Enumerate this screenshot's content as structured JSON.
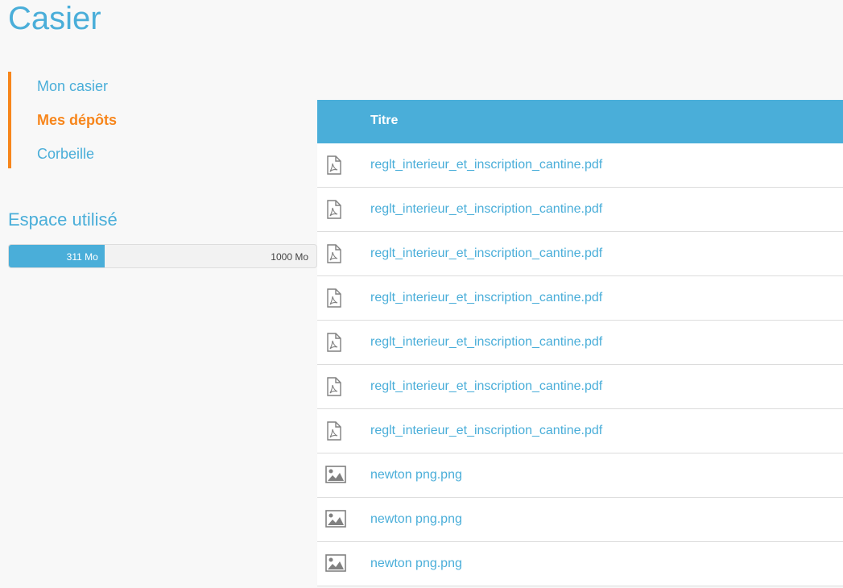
{
  "page": {
    "title": "Casier"
  },
  "nav": {
    "items": [
      {
        "label": "Mon casier",
        "active": false
      },
      {
        "label": "Mes dépôts",
        "active": true
      },
      {
        "label": "Corbeille",
        "active": false
      }
    ]
  },
  "usage": {
    "title": "Espace utilisé",
    "used_label": "311 Mo",
    "total_label": "1000 Mo",
    "used_fraction": 0.311
  },
  "table": {
    "header_title": "Titre",
    "rows": [
      {
        "icon": "pdf-file-icon",
        "name": "reglt_interieur_et_inscription_cantine.pdf"
      },
      {
        "icon": "pdf-file-icon",
        "name": "reglt_interieur_et_inscription_cantine.pdf"
      },
      {
        "icon": "pdf-file-icon",
        "name": "reglt_interieur_et_inscription_cantine.pdf"
      },
      {
        "icon": "pdf-file-icon",
        "name": "reglt_interieur_et_inscription_cantine.pdf"
      },
      {
        "icon": "pdf-file-icon",
        "name": "reglt_interieur_et_inscription_cantine.pdf"
      },
      {
        "icon": "pdf-file-icon",
        "name": "reglt_interieur_et_inscription_cantine.pdf"
      },
      {
        "icon": "pdf-file-icon",
        "name": "reglt_interieur_et_inscription_cantine.pdf"
      },
      {
        "icon": "image-file-icon",
        "name": "newton png.png"
      },
      {
        "icon": "image-file-icon",
        "name": "newton png.png"
      },
      {
        "icon": "image-file-icon",
        "name": "newton png.png"
      }
    ]
  },
  "colors": {
    "accent": "#4aaed9",
    "active": "#f7861c"
  }
}
